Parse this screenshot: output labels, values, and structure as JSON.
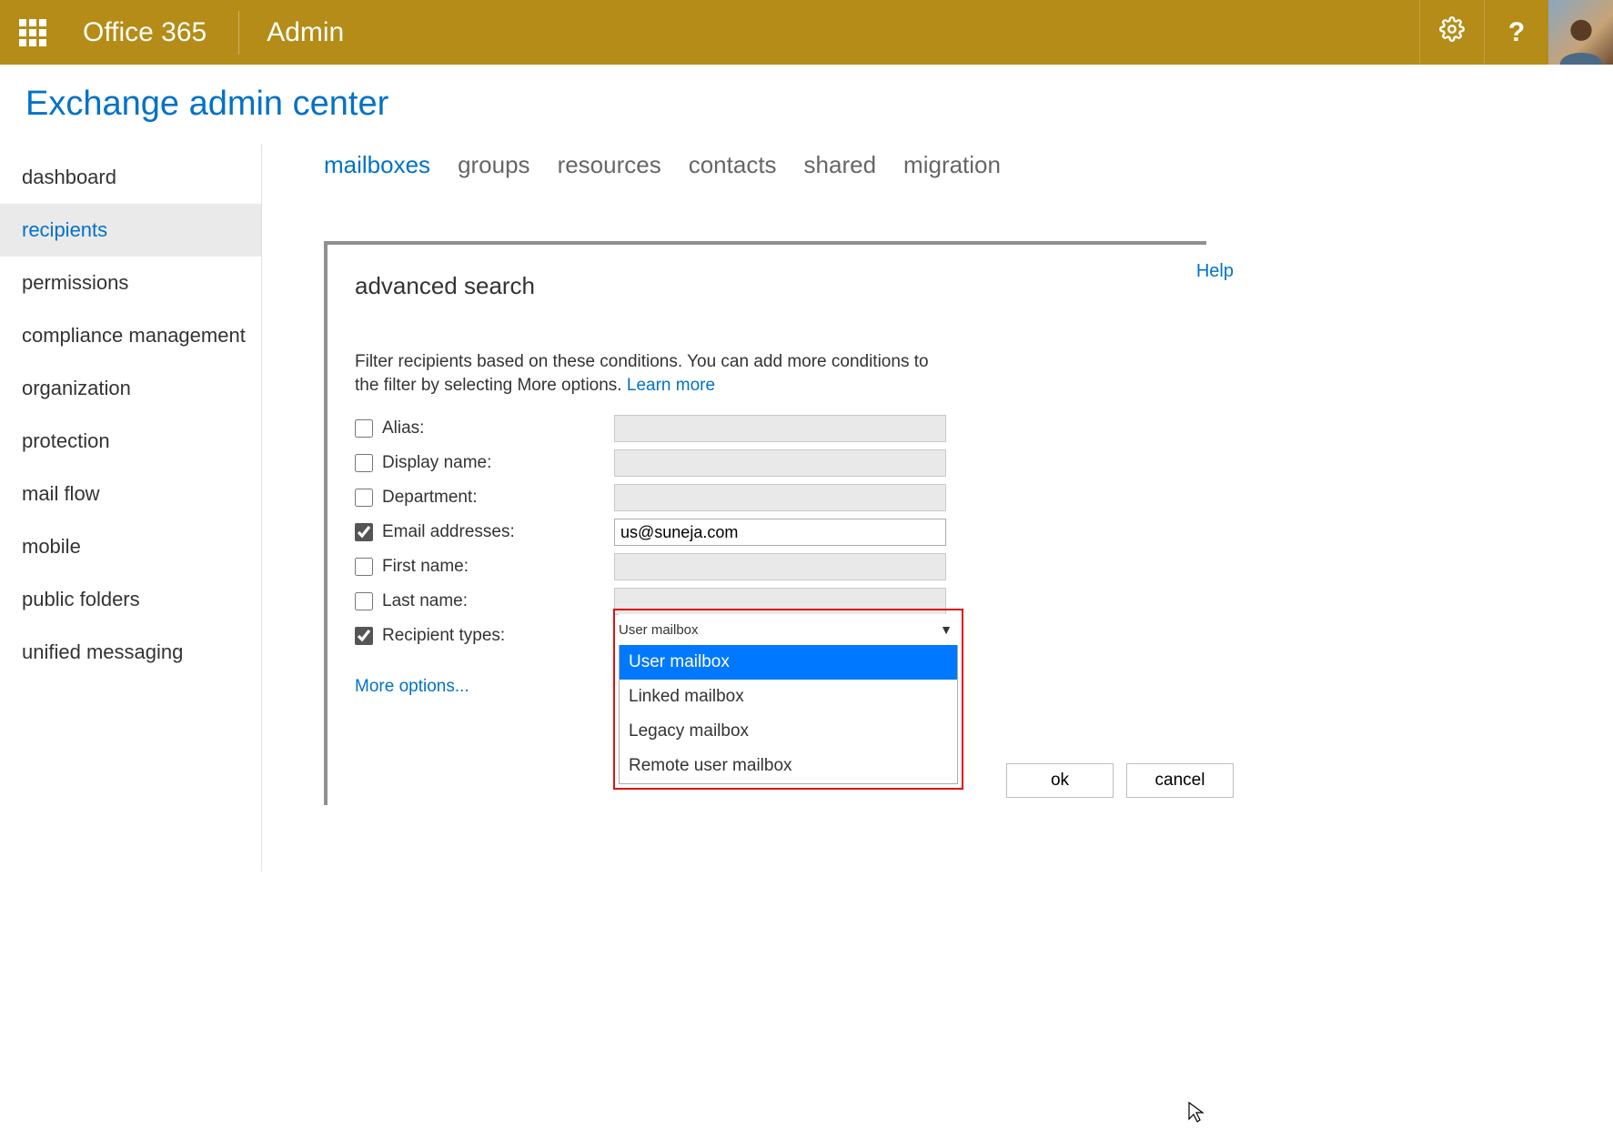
{
  "topbar": {
    "brand": "Office 365",
    "app": "Admin"
  },
  "page_title": "Exchange admin center",
  "sidebar": {
    "items": [
      {
        "label": "dashboard",
        "selected": false
      },
      {
        "label": "recipients",
        "selected": true
      },
      {
        "label": "permissions",
        "selected": false
      },
      {
        "label": "compliance management",
        "selected": false
      },
      {
        "label": "organization",
        "selected": false
      },
      {
        "label": "protection",
        "selected": false
      },
      {
        "label": "mail flow",
        "selected": false
      },
      {
        "label": "mobile",
        "selected": false
      },
      {
        "label": "public folders",
        "selected": false
      },
      {
        "label": "unified messaging",
        "selected": false
      }
    ]
  },
  "tabs": {
    "items": [
      {
        "label": "mailboxes",
        "active": true
      },
      {
        "label": "groups",
        "active": false
      },
      {
        "label": "resources",
        "active": false
      },
      {
        "label": "contacts",
        "active": false
      },
      {
        "label": "shared",
        "active": false
      },
      {
        "label": "migration",
        "active": false
      }
    ]
  },
  "dialog": {
    "title": "advanced search",
    "help_label": "Help",
    "instructions_pre": "Filter recipients based on these conditions. You can add more conditions to the filter by selecting More options. ",
    "learn_more": "Learn more",
    "more_options": "More options...",
    "rows": [
      {
        "label": "Alias:",
        "checked": false,
        "value": ""
      },
      {
        "label": "Display name:",
        "checked": false,
        "value": ""
      },
      {
        "label": "Department:",
        "checked": false,
        "value": ""
      },
      {
        "label": "Email addresses:",
        "checked": true,
        "value": "us@suneja.com"
      },
      {
        "label": "First name:",
        "checked": false,
        "value": ""
      },
      {
        "label": "Last name:",
        "checked": false,
        "value": ""
      },
      {
        "label": "Recipient types:",
        "checked": true,
        "value": "User mailbox",
        "type": "select"
      }
    ],
    "recipient_type_options": [
      "User mailbox",
      "Linked mailbox",
      "Legacy mailbox",
      "Remote user mailbox"
    ],
    "highlighted_option": "User mailbox",
    "ok_label": "ok",
    "cancel_label": "cancel"
  }
}
